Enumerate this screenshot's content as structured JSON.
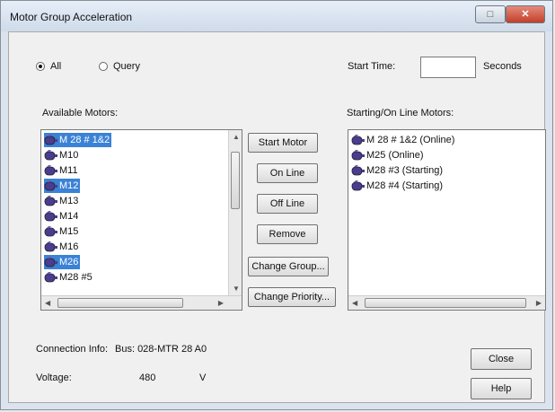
{
  "window": {
    "title": "Motor Group Acceleration"
  },
  "mode": {
    "all_label": "All",
    "query_label": "Query",
    "selected": "All"
  },
  "start_time": {
    "label": "Start Time:",
    "value": "",
    "unit": "Seconds"
  },
  "available": {
    "label": "Available Motors:",
    "items": [
      {
        "text": "M 28 # 1&2",
        "selected": true
      },
      {
        "text": "M10",
        "selected": false
      },
      {
        "text": "M11",
        "selected": false
      },
      {
        "text": "M12",
        "selected": true
      },
      {
        "text": "M13",
        "selected": false
      },
      {
        "text": "M14",
        "selected": false
      },
      {
        "text": "M15",
        "selected": false
      },
      {
        "text": "M16",
        "selected": false
      },
      {
        "text": "M26",
        "selected": true
      },
      {
        "text": "M28 #5",
        "selected": false
      }
    ]
  },
  "starting": {
    "label": "Starting/On Line Motors:",
    "items": [
      {
        "text": "M 28 # 1&2 (Online)"
      },
      {
        "text": "M25 (Online)"
      },
      {
        "text": "M28 #3 (Starting)"
      },
      {
        "text": "M28 #4 (Starting)"
      }
    ]
  },
  "actions": {
    "start_motor": "Start Motor",
    "on_line": "On Line",
    "off_line": "Off Line",
    "remove": "Remove",
    "change_group": "Change Group...",
    "change_priority": "Change Priority..."
  },
  "connection": {
    "label": "Connection Info:",
    "value": "Bus: 028-MTR 28 A0"
  },
  "voltage": {
    "label": "Voltage:",
    "value": "480",
    "unit": "V"
  },
  "footer": {
    "close": "Close",
    "help": "Help"
  },
  "icon_names": {
    "motor": "motor-icon",
    "minimize": "window-help-icon",
    "close": "close-icon"
  }
}
